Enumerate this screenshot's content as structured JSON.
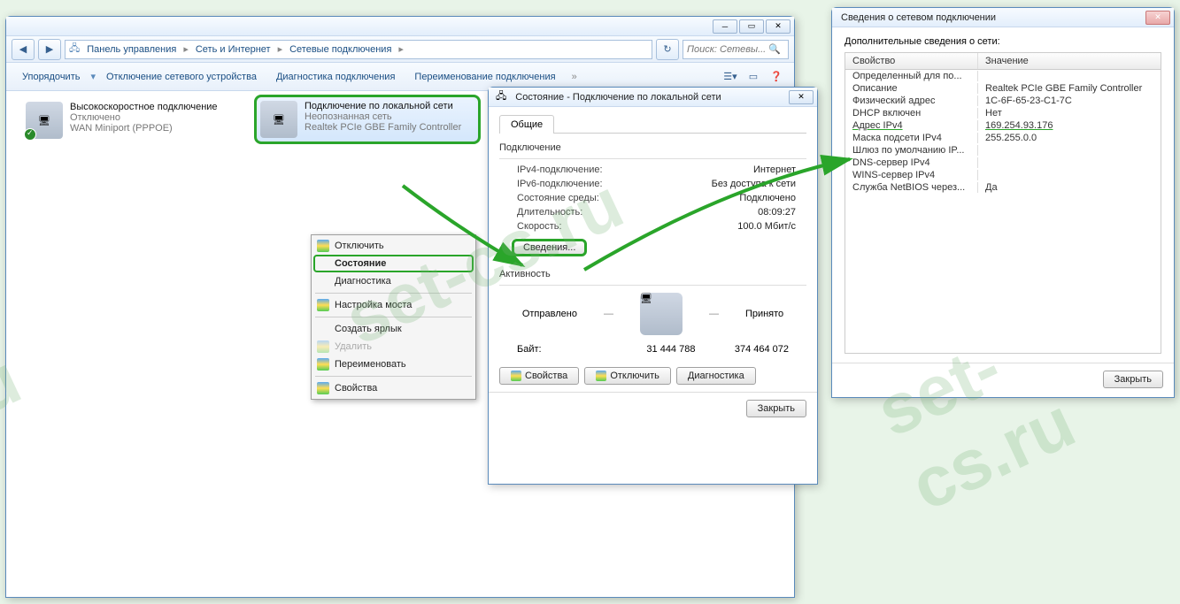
{
  "explorer": {
    "breadcrumb": [
      "Панель управления",
      "Сеть и Интернет",
      "Сетевые подключения"
    ],
    "search_placeholder": "Поиск: Сетевы...",
    "toolbar": {
      "organize": "Упорядочить",
      "disable": "Отключение сетевого устройства",
      "diagnose": "Диагностика подключения",
      "rename": "Переименование подключения"
    },
    "connections": [
      {
        "name": "Высокоскоростное подключение",
        "status": "Отключено",
        "device": "WAN Miniport (PPPOE)"
      },
      {
        "name": "Подключение по локальной сети",
        "status": "Неопознанная сеть",
        "device": "Realtek PCIe GBE Family Controller"
      }
    ]
  },
  "context_menu": {
    "items": [
      "Отключить",
      "Состояние",
      "Диагностика",
      "Настройка моста",
      "Создать ярлык",
      "Удалить",
      "Переименовать",
      "Свойства"
    ]
  },
  "status_dialog": {
    "title": "Состояние - Подключение по локальной сети",
    "tab": "Общие",
    "group1": "Подключение",
    "rows1": [
      {
        "label": "IPv4-подключение:",
        "value": "Интернет"
      },
      {
        "label": "IPv6-подключение:",
        "value": "Без доступа к сети"
      },
      {
        "label": "Состояние среды:",
        "value": "Подключено"
      },
      {
        "label": "Длительность:",
        "value": "08:09:27"
      },
      {
        "label": "Скорость:",
        "value": "100.0 Мбит/с"
      }
    ],
    "details_btn": "Сведения...",
    "group2": "Активность",
    "sent_label": "Отправлено",
    "recv_label": "Принято",
    "bytes_label": "Байт:",
    "sent_bytes": "31 444 788",
    "recv_bytes": "374 464 072",
    "btns": {
      "props": "Свойства",
      "disable": "Отключить",
      "diag": "Диагностика"
    },
    "close": "Закрыть"
  },
  "details_dialog": {
    "title": "Сведения о сетевом подключении",
    "subtitle": "Дополнительные сведения о сети:",
    "col1": "Свойство",
    "col2": "Значение",
    "rows": [
      {
        "p": "Определенный для по...",
        "v": ""
      },
      {
        "p": "Описание",
        "v": "Realtek PCIe GBE Family Controller"
      },
      {
        "p": "Физический адрес",
        "v": "1C-6F-65-23-C1-7C"
      },
      {
        "p": "DHCP включен",
        "v": "Нет"
      },
      {
        "p": "Адрес IPv4",
        "v": "169.254.93.176",
        "hl": true
      },
      {
        "p": "Маска подсети IPv4",
        "v": "255.255.0.0"
      },
      {
        "p": "Шлюз по умолчанию IP...",
        "v": ""
      },
      {
        "p": "DNS-сервер IPv4",
        "v": ""
      },
      {
        "p": "WINS-сервер IPv4",
        "v": ""
      },
      {
        "p": "Служба NetBIOS через...",
        "v": "Да"
      }
    ],
    "close": "Закрыть"
  }
}
